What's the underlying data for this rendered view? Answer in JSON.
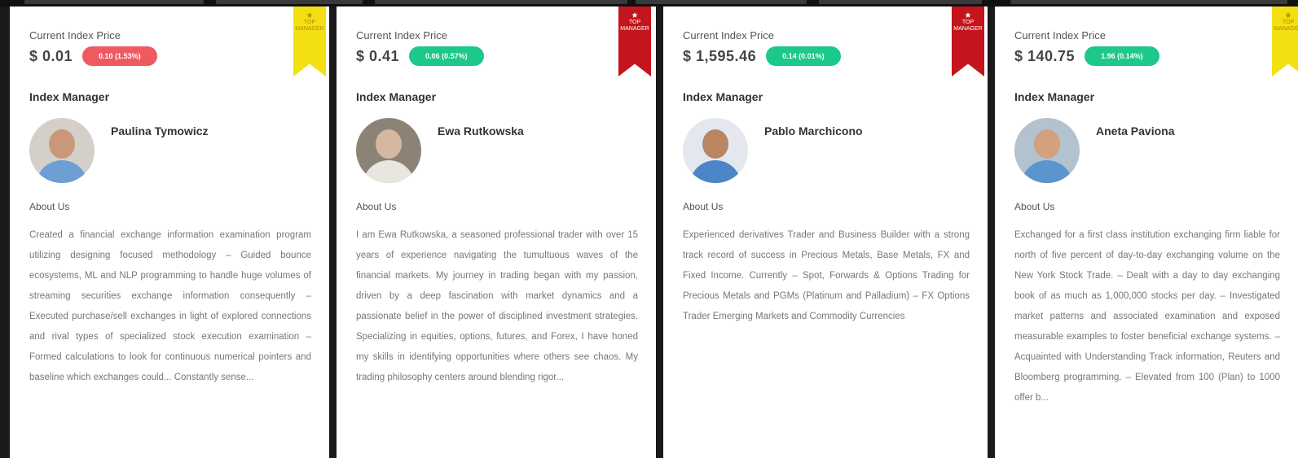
{
  "colors": {
    "negative_badge": "#ef5a61",
    "positive_badge": "#1cc88a",
    "ribbon_yellow": "#f3e012",
    "ribbon_red": "#c4151c"
  },
  "cards": [
    {
      "price_label": "Current Index Price",
      "price": "$ 0.01",
      "change": "0.10 (1.53%)",
      "change_status": "negative",
      "ribbon": "yellow",
      "ribbon_text": "TOP MANAGER",
      "ribbon_icon": "star-icon",
      "manager_label": "Index Manager",
      "manager_name": "Paulina Tymowicz",
      "about_label": "About Us",
      "about_text": "Created a financial exchange information examination program utilizing designing focused methodology – Guided bounce ecosystems, ML and NLP programming to handle huge volumes of streaming securities exchange information consequently – Executed purchase/sell exchanges in light of explored connections and rival types of specialized stock execution examination – Formed calculations to look for continuous numerical pointers and baseline which exchanges could... Constantly sense..."
    },
    {
      "price_label": "Current Index Price",
      "price": "$ 0.41",
      "change": "0.06 (0.57%)",
      "change_status": "positive",
      "ribbon": "red",
      "ribbon_text": "TOP MANAGER",
      "ribbon_icon": "star-icon",
      "manager_label": "Index Manager",
      "manager_name": "Ewa Rutkowska",
      "about_label": "About Us",
      "about_text": "I am Ewa Rutkowska, a seasoned professional trader with over 15 years of experience navigating the tumultuous waves of the financial markets. My journey in trading began with my passion, driven by a deep fascination with market dynamics and a passionate belief in the power of disciplined investment strategies. Specializing in equities, options, futures, and Forex, I have honed my skills in identifying opportunities where others see chaos. My trading philosophy centers around blending rigor..."
    },
    {
      "price_label": "Current Index Price",
      "price": "$ 1,595.46",
      "change": "0.14 (0.01%)",
      "change_status": "positive",
      "ribbon": "red",
      "ribbon_text": "TOP MANAGER",
      "ribbon_icon": "star-icon",
      "manager_label": "Index Manager",
      "manager_name": "Pablo Marchicono",
      "about_label": "About Us",
      "about_text": "Experienced derivatives Trader and Business Builder with a strong track record of success in Precious Metals, Base Metals, FX and Fixed Income. Currently – Spot, Forwards & Options Trading for Precious Metals and PGMs (Platinum and Palladium) – FX Options Trader Emerging Markets and Commodity Currencies"
    },
    {
      "price_label": "Current Index Price",
      "price": "$ 140.75",
      "change": "1.96 (0.14%)",
      "change_status": "positive",
      "ribbon": "yellow",
      "ribbon_text": "TOP MANAGER",
      "ribbon_icon": "star-icon",
      "manager_label": "Index Manager",
      "manager_name": "Aneta Paviona",
      "about_label": "About Us",
      "about_text": "Exchanged for a first class institution exchanging firm liable for north of five percent of day-to-day exchanging volume on the New York Stock Trade. – Dealt with a day to day exchanging book of as much as 1,000,000 stocks per day. – Investigated market patterns and associated examination and exposed measurable examples to foster beneficial exchange systems. – Acquainted with Understanding Track information, Reuters and Bloomberg programming. – Elevated from 100 (Plan) to 1000 offer b..."
    }
  ]
}
